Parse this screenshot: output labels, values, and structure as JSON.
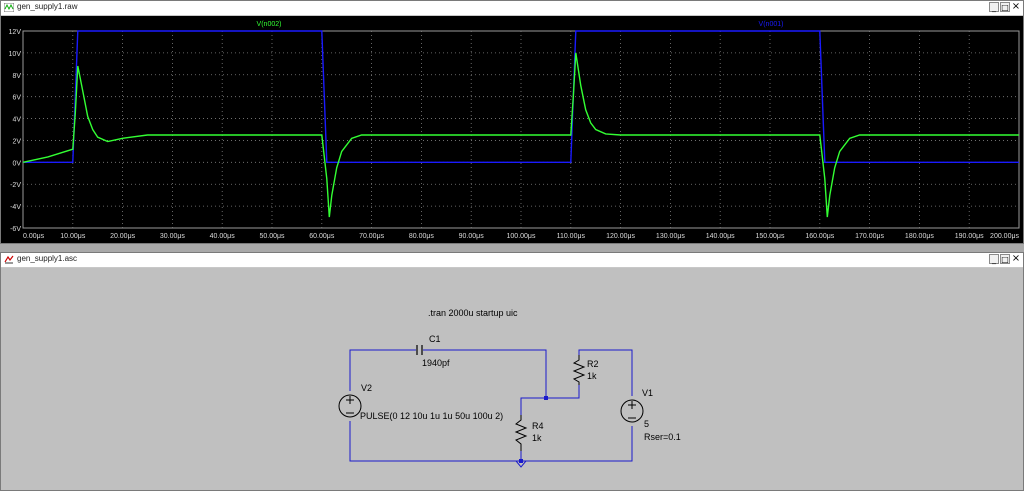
{
  "plot_window": {
    "title": "gen_supply1.raw",
    "icon": "waveform-icon",
    "buttons": {
      "minimize": "_",
      "restore": "□",
      "close": "×"
    }
  },
  "schematic_window": {
    "title": "gen_supply1.asc",
    "icon": "schematic-icon",
    "buttons": {
      "minimize": "_",
      "restore": "□",
      "close": "×"
    }
  },
  "colors": {
    "trace_green": "#33ff33",
    "trace_blue": "#1a1aff",
    "grid": "#808080",
    "wire": "#1a1acc",
    "component": "#000000"
  },
  "chart_data": {
    "type": "line",
    "xlim": [
      0,
      200
    ],
    "ylim": [
      -6,
      12
    ],
    "x_unit": "μs",
    "grid": true,
    "x_ticks": [
      "0.00μs",
      "10.00μs",
      "20.00μs",
      "30.00μs",
      "40.00μs",
      "50.00μs",
      "60.00μs",
      "70.00μs",
      "80.00μs",
      "90.00μs",
      "100.00μs",
      "110.00μs",
      "120.00μs",
      "130.00μs",
      "140.00μs",
      "150.00μs",
      "160.00μs",
      "170.00μs",
      "180.00μs",
      "190.00μs",
      "200.00μs"
    ],
    "x_tick_values": [
      0,
      10,
      20,
      30,
      40,
      50,
      60,
      70,
      80,
      90,
      100,
      110,
      120,
      130,
      140,
      150,
      160,
      170,
      180,
      190,
      200
    ],
    "y_ticks": [
      "12V",
      "10V",
      "8V",
      "6V",
      "4V",
      "2V",
      "0V",
      "-2V",
      "-4V",
      "-6V"
    ],
    "y_tick_values": [
      12,
      10,
      8,
      6,
      4,
      2,
      0,
      -2,
      -4,
      -6
    ],
    "series": [
      {
        "name": "V(n002)",
        "color": "#33ff33",
        "x": [
          0,
          5,
          10,
          10.5,
          11,
          12,
          13,
          14,
          15,
          17,
          20,
          25,
          30,
          40,
          50,
          60,
          61,
          61.5,
          62,
          63,
          64,
          66,
          68,
          70,
          80,
          100,
          110,
          110.5,
          111,
          112,
          113,
          114,
          115,
          117,
          120,
          125,
          130,
          150,
          160,
          161,
          161.5,
          162,
          163,
          164,
          166,
          168,
          170,
          185,
          200
        ],
        "y": [
          0,
          0.5,
          1.2,
          4.5,
          8.8,
          6.5,
          4.2,
          3.0,
          2.3,
          1.9,
          2.2,
          2.5,
          2.5,
          2.5,
          2.5,
          2.5,
          -1.5,
          -5.0,
          -3.0,
          -0.5,
          1.0,
          2.2,
          2.5,
          2.5,
          2.5,
          2.5,
          2.5,
          6.0,
          10.0,
          7.0,
          4.8,
          3.6,
          3.0,
          2.6,
          2.5,
          2.5,
          2.5,
          2.5,
          2.5,
          -1.5,
          -5.0,
          -3.0,
          -0.5,
          1.0,
          2.2,
          2.5,
          2.5,
          2.5,
          2.5
        ]
      },
      {
        "name": "V(n001)",
        "color": "#1a1aff",
        "x": [
          0,
          10,
          11,
          60,
          61,
          110,
          111,
          160,
          161,
          200
        ],
        "y": [
          0,
          0,
          12,
          12,
          0,
          0,
          12,
          12,
          0,
          0
        ]
      }
    ]
  },
  "schematic": {
    "directive": ".tran 2000u startup uic",
    "components": {
      "c1": {
        "ref": "C1",
        "value": "1940pf"
      },
      "v2": {
        "ref": "V2",
        "value": "PULSE(0 12 10u 1u 1u 50u 100u 2)"
      },
      "r2": {
        "ref": "R2",
        "value": "1k"
      },
      "r4": {
        "ref": "R4",
        "value": "1k"
      },
      "v1": {
        "ref": "V1",
        "value": "5",
        "extra": "Rser=0.1"
      }
    }
  }
}
